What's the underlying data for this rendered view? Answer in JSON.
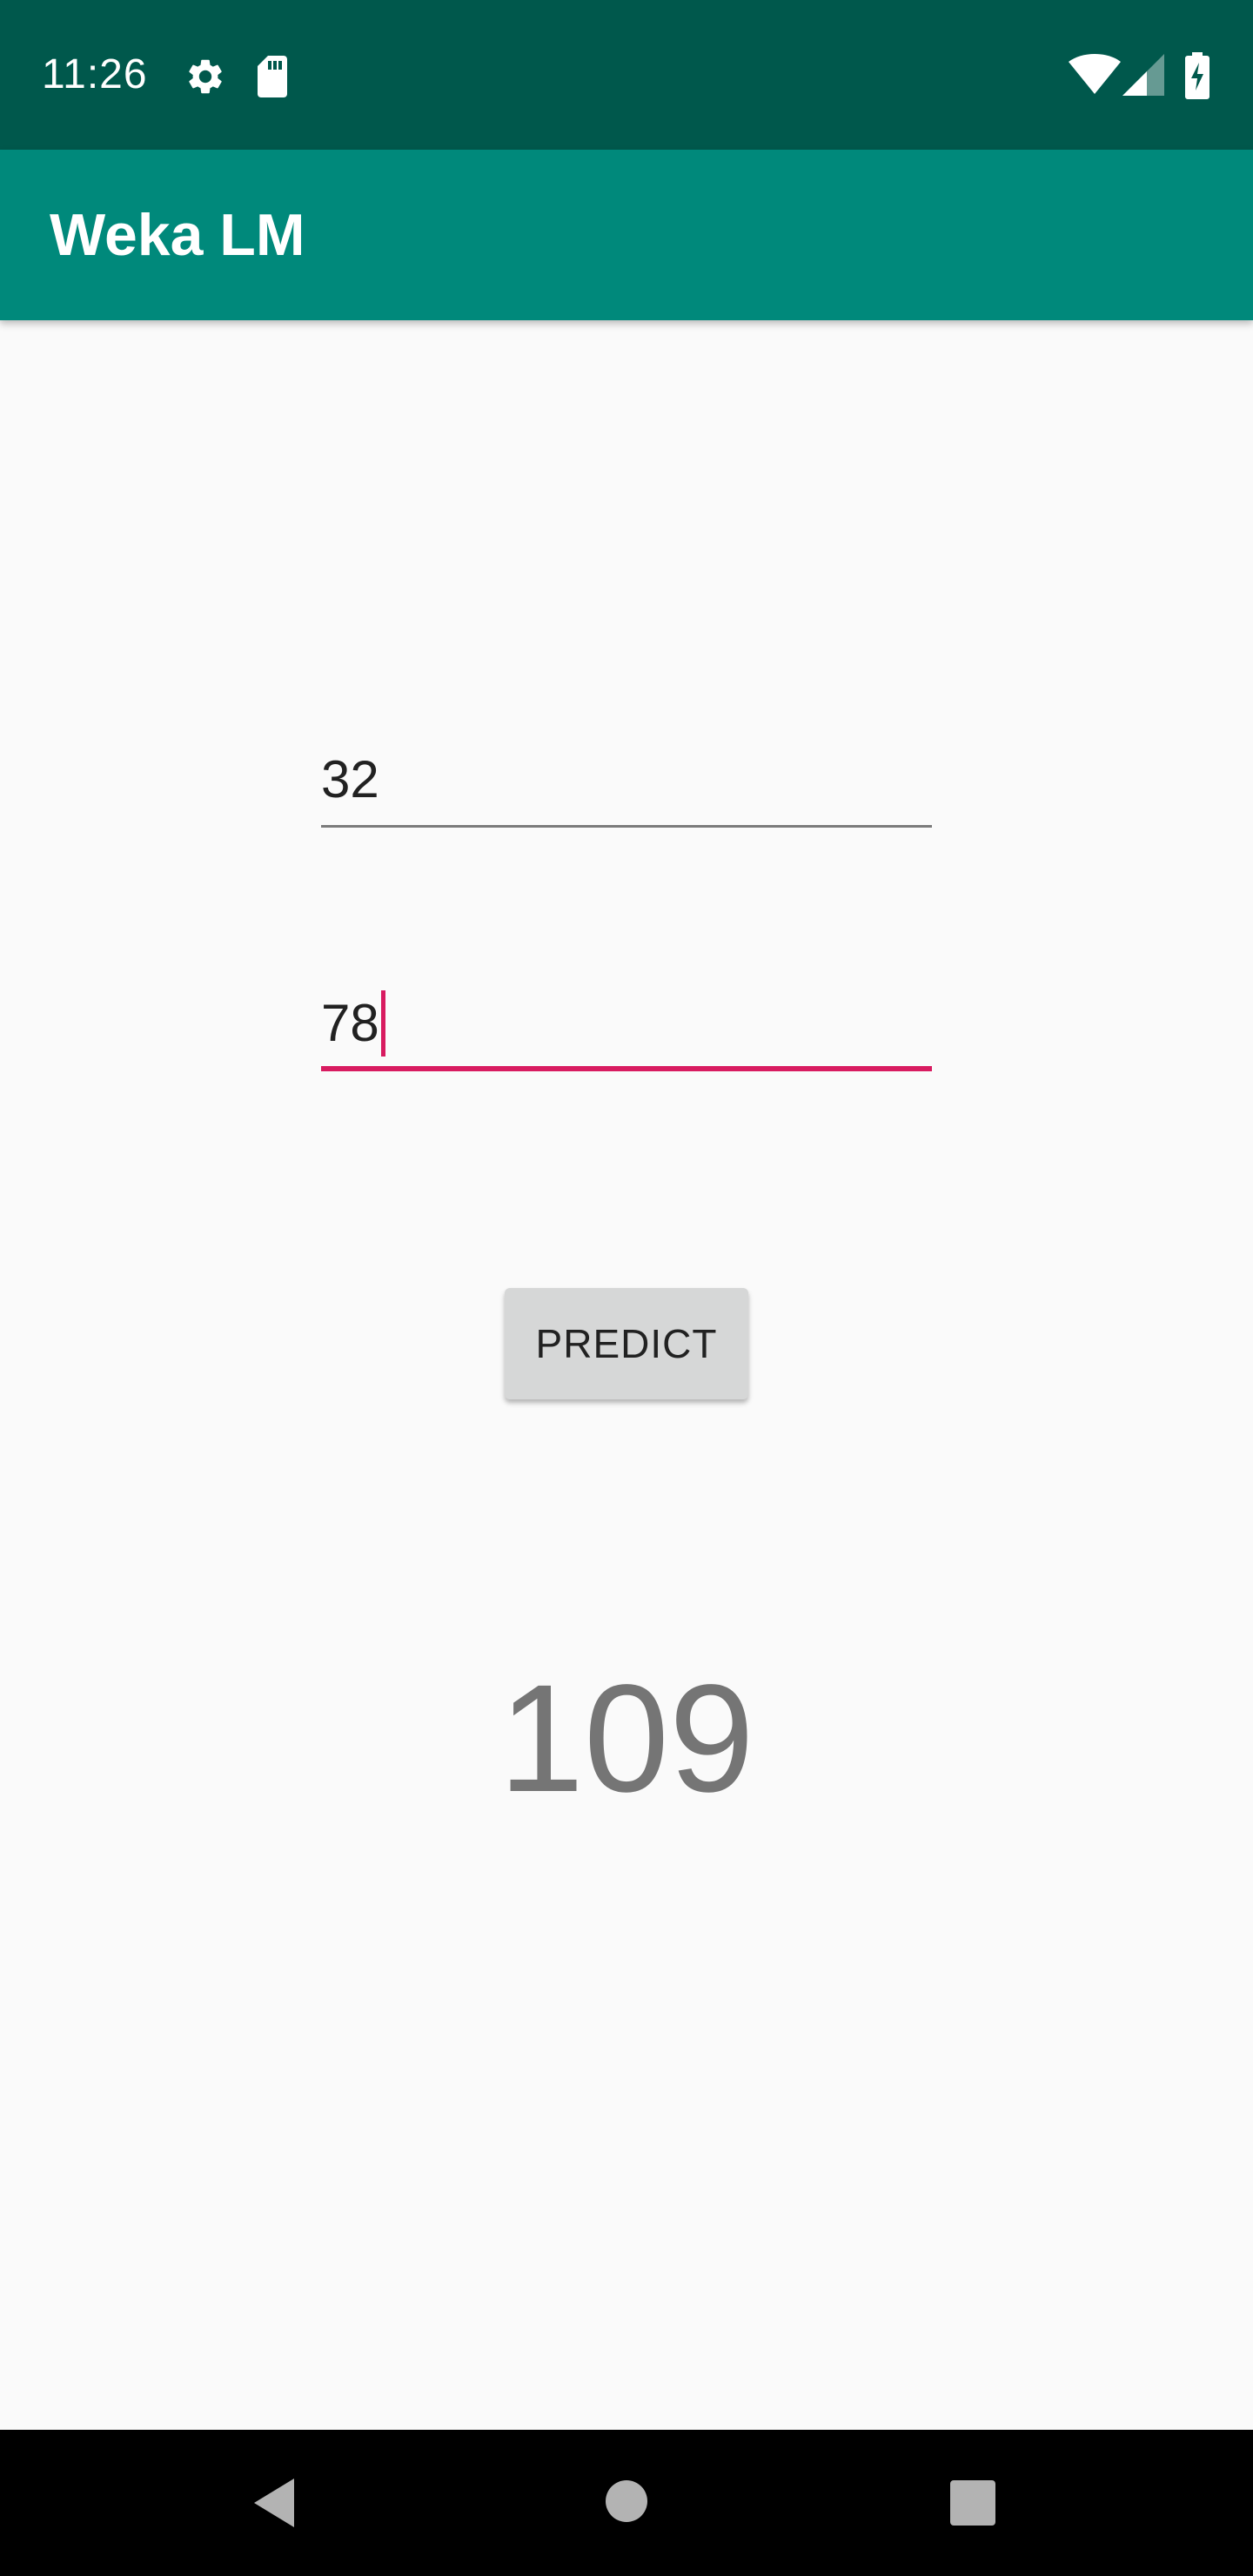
{
  "status_bar": {
    "time": "11:26",
    "icons": [
      "settings-icon",
      "sd-card-icon",
      "wifi-icon",
      "signal-icon",
      "battery-charging-icon"
    ],
    "background": "#00584c"
  },
  "app_bar": {
    "title": "Weka LM",
    "background": "#00897b"
  },
  "form": {
    "input1": {
      "value": "32"
    },
    "input2": {
      "value": "78",
      "focused": true
    },
    "predict_label": "PREDICT",
    "accent": "#d81b60"
  },
  "result": {
    "value": "109"
  },
  "nav_bar": {
    "icons": [
      "back-icon",
      "home-icon",
      "recents-icon"
    ]
  }
}
